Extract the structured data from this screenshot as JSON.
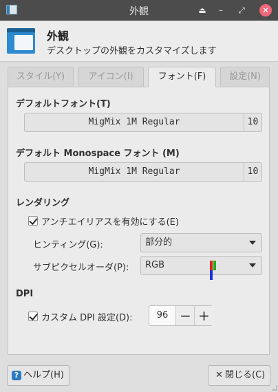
{
  "window": {
    "title": "外観"
  },
  "header": {
    "title": "外観",
    "subtitle": "デスクトップの外観をカスタマイズします"
  },
  "tabs": [
    {
      "label": "スタイル(Y)",
      "active": false
    },
    {
      "label": "アイコン(I)",
      "active": false
    },
    {
      "label": "フォント(F)",
      "active": true
    },
    {
      "label": "設定(N)",
      "active": false
    }
  ],
  "default_font": {
    "title": "デフォルトフォント(T)",
    "name": "MigMix 1M Regular",
    "size": "10"
  },
  "mono_font": {
    "title": "デフォルト Monospace フォント (M)",
    "name": "MigMix 1M Regular",
    "size": "10"
  },
  "rendering": {
    "title": "レンダリング",
    "antialias_label": "アンチエイリアスを有効にする(E)",
    "antialias_checked": true,
    "hinting_label": "ヒンティング(G):",
    "hinting_value": "部分的",
    "subpixel_label": "サブピクセルオーダ(P):",
    "subpixel_value": "RGB"
  },
  "dpi": {
    "title": "DPI",
    "custom_label": "カスタム DPI 設定(D):",
    "custom_checked": true,
    "value": "96",
    "minus": "−",
    "plus": "+"
  },
  "buttons": {
    "help": "ヘルプ(H)",
    "close": "閉じる(C)"
  },
  "icons": {
    "help": "help-icon",
    "close": "close-icon",
    "rgb_colors": [
      "#e0201c",
      "#1db31d",
      "#1c2fe0"
    ]
  }
}
